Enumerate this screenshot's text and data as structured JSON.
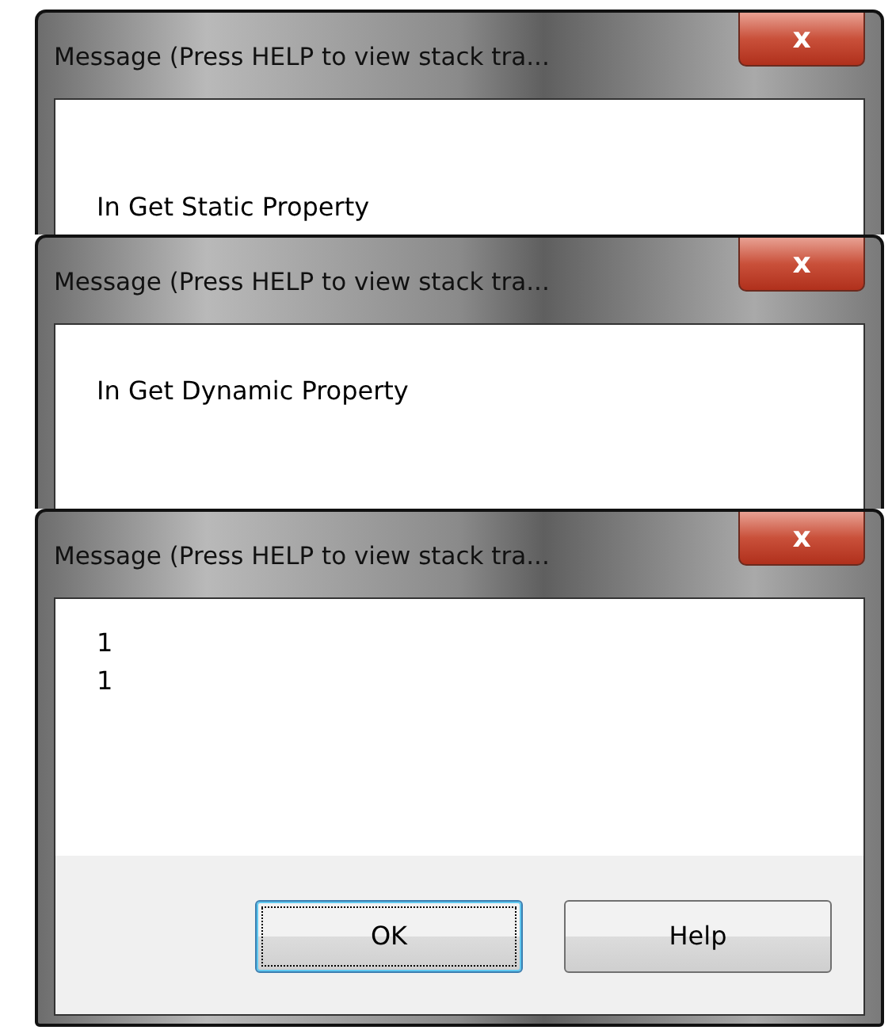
{
  "dialogs": [
    {
      "title": "Message (Press HELP to view stack tra...",
      "close": "x",
      "lines": [
        "In Get Static Property"
      ]
    },
    {
      "title": "Message (Press HELP to view stack tra...",
      "close": "x",
      "lines": [
        "In Get Dynamic Property"
      ]
    },
    {
      "title": "Message (Press HELP to view stack tra...",
      "close": "x",
      "lines": [
        "1",
        "1"
      ],
      "buttons": [
        {
          "label": "OK",
          "focused": true
        },
        {
          "label": "Help",
          "focused": false
        }
      ]
    }
  ]
}
